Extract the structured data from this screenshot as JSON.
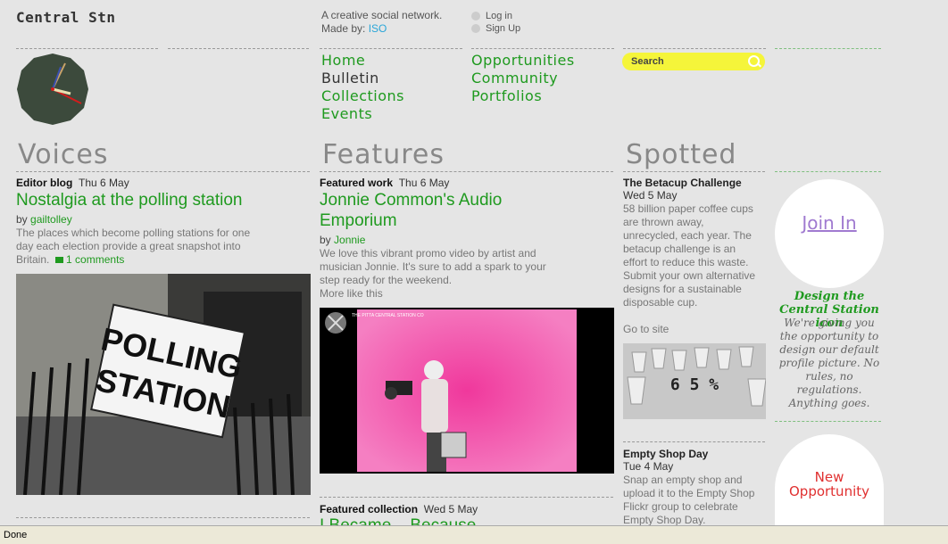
{
  "header": {
    "logo": "Central Stn",
    "tagline": "A creative social network.",
    "made_by_label": "Made by:",
    "made_by_link": "ISO",
    "login": "Log in",
    "signup": "Sign Up"
  },
  "nav": {
    "col1": [
      "Home",
      "Bulletin",
      "Collections",
      "Events"
    ],
    "col2": [
      "Opportunities",
      "Community",
      "Portfolios"
    ]
  },
  "search": {
    "placeholder": "Search"
  },
  "voices": {
    "heading": "Voices",
    "category": "Editor blog",
    "date": "Thu 6 May",
    "title": "Nostalgia at the polling station",
    "by": "by",
    "author": "gailtolley",
    "body": "The places which become polling stations for one day each election provide a great snapshot into Britain.",
    "comments": "1 comments",
    "sign_line1": "POLLING",
    "sign_line2": "STATION"
  },
  "features": {
    "heading": "Features",
    "category": "Featured work",
    "date": "Thu 6 May",
    "title_line1": "Jonnie Common's Audio",
    "title_line2": "Emporium",
    "by": "by",
    "author": "Jonnie",
    "body": "We love this vibrant promo video by artist and musician Jonnie. It's sure to add a spark to your step ready for the weekend.",
    "more": "More like this",
    "video_caption": "THE PITTA CENTRAL STATION CO",
    "collection_category": "Featured collection",
    "collection_date": "Wed 5 May",
    "collection_title": "I Became... Because"
  },
  "spotted": {
    "heading": "Spotted",
    "item1_title": "The Betacup Challenge",
    "item1_date": "Wed 5 May",
    "item1_body": "58 billion paper coffee cups are thrown away, unrecycled, each year. The betacup challenge is an effort to reduce this waste. Submit your own alternative designs for a sustainable disposable cup.",
    "item1_link": "Go to site",
    "cups_label": "6 5 %",
    "item2_title": "Empty Shop Day",
    "item2_date": "Tue 4 May",
    "item2_body": "Snap an empty shop and upload it to the Empty Shop Flickr group to celebrate Empty Shop Day."
  },
  "sidebar": {
    "join": "Join In",
    "promo_title": "Design the Central Station icon",
    "promo_body": "We're giving you the opportunity to design our default profile picture. No rules, no regulations. Anything goes.",
    "new_opp": "New Opportunity"
  },
  "status": {
    "text": "Done"
  },
  "colors": {
    "accent": "#1f9a1f",
    "search": "#f5f53a",
    "pink": "#f0389c"
  }
}
